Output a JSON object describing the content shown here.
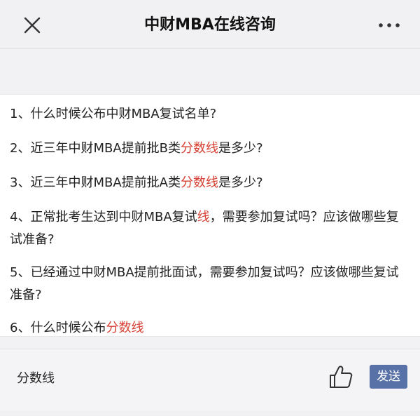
{
  "header": {
    "title": "中财MBA在线咨询",
    "close_icon": "close-icon",
    "more_icon": "more-dots-icon"
  },
  "questions": [
    {
      "parts": [
        {
          "text": "1、什么时候公布中财MBA复试名单?",
          "highlight": false
        }
      ]
    },
    {
      "parts": [
        {
          "text": "2、近三年中财MBA提前批B类",
          "highlight": false
        },
        {
          "text": "分数线",
          "highlight": true
        },
        {
          "text": "是多少?",
          "highlight": false
        }
      ]
    },
    {
      "parts": [
        {
          "text": "3、近三年中财MBA提前批A类",
          "highlight": false
        },
        {
          "text": "分数线",
          "highlight": true
        },
        {
          "text": "是多少?",
          "highlight": false
        }
      ]
    },
    {
      "parts": [
        {
          "text": "4、正常批考生达到中财MBA复试",
          "highlight": false
        },
        {
          "text": "线",
          "highlight": true
        },
        {
          "text": "，需要参加复试吗？应该做哪些复试准备?",
          "highlight": false
        }
      ]
    },
    {
      "parts": [
        {
          "text": "5、已经通过中财MBA提前批面试，需要参加复试吗？应该做哪些复试准备?",
          "highlight": false
        }
      ]
    },
    {
      "parts": [
        {
          "text": "6、什么时候公布",
          "highlight": false
        },
        {
          "text": "分数线",
          "highlight": true
        }
      ]
    }
  ],
  "input": {
    "value": "分数线"
  },
  "actions": {
    "like_icon": "thumbs-up-icon",
    "send_label": "发送"
  },
  "colors": {
    "highlight": "#d64032",
    "send_button": "#5872a8"
  }
}
